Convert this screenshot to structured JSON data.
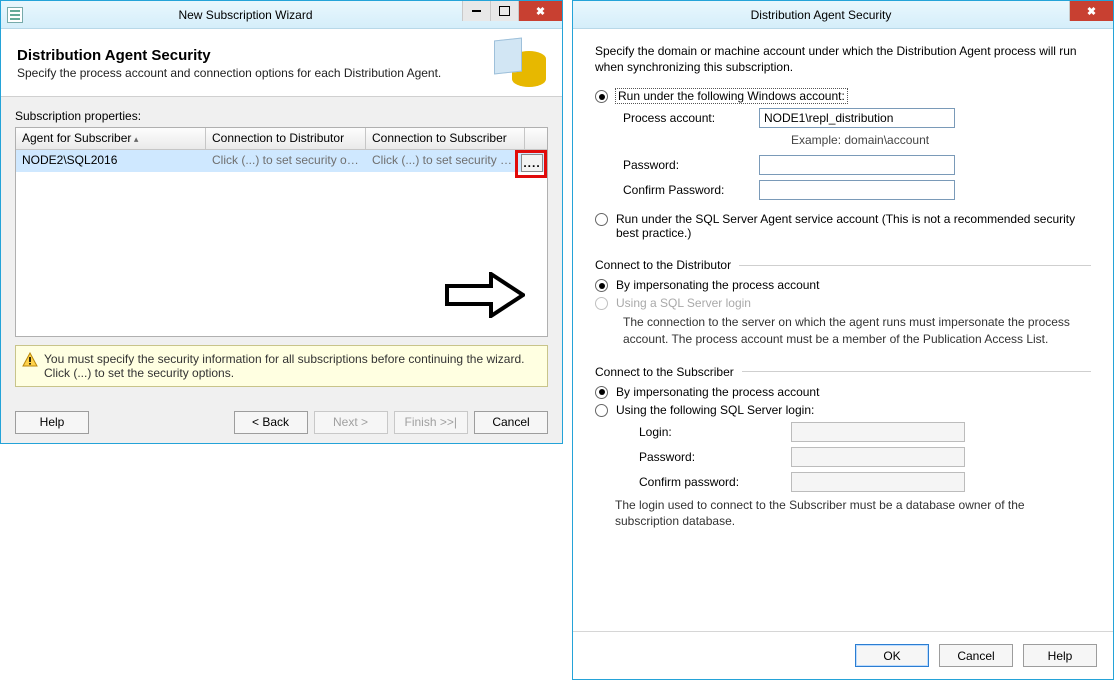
{
  "wizard": {
    "title": "New Subscription Wizard",
    "heading": "Distribution Agent Security",
    "subheading": "Specify the process account and connection options for each Distribution Agent.",
    "props_label": "Subscription properties:",
    "columns": {
      "agent": "Agent for Subscriber",
      "distributor": "Connection to Distributor",
      "subscriber": "Connection to Subscriber"
    },
    "row": {
      "agent": "NODE2\\SQL2016",
      "distributor": "Click (...) to set security opti...",
      "subscriber": "Click (...) to set security opti..."
    },
    "ellipsis_button": "....",
    "warning": "You must specify the security information for all subscriptions before continuing the wizard. Click (...) to set the security options.",
    "buttons": {
      "help": "Help",
      "back": "< Back",
      "next": "Next >",
      "finish": "Finish >>|",
      "cancel": "Cancel"
    }
  },
  "dialog": {
    "title": "Distribution Agent Security",
    "intro": "Specify the domain or machine account under which the Distribution Agent process will run when synchronizing this subscription.",
    "run_windows": "Run under the following Windows account:",
    "process_account_label": "Process account:",
    "process_account_value": "NODE1\\repl_distribution",
    "example": "Example: domain\\account",
    "password_label": "Password:",
    "confirm_password_label": "Confirm Password:",
    "run_sqlagent": "Run under the SQL Server Agent service account (This is not a recommended security best practice.)",
    "group_distributor": "Connect to the Distributor",
    "dist_impersonate": "By impersonating the process account",
    "dist_sql_login": "Using a SQL Server login",
    "dist_note": "The connection to the server on which the agent runs must impersonate the process account. The process account must be a member of the Publication Access List.",
    "group_subscriber": "Connect to the Subscriber",
    "sub_impersonate": "By impersonating the process account",
    "sub_sql_login": "Using the following SQL Server login:",
    "login_label": "Login:",
    "sub_password_label": "Password:",
    "sub_confirm_label": "Confirm password:",
    "sub_note": "The login used to connect to the Subscriber must be a database owner of the subscription database.",
    "buttons": {
      "ok": "OK",
      "cancel": "Cancel",
      "help": "Help"
    }
  }
}
